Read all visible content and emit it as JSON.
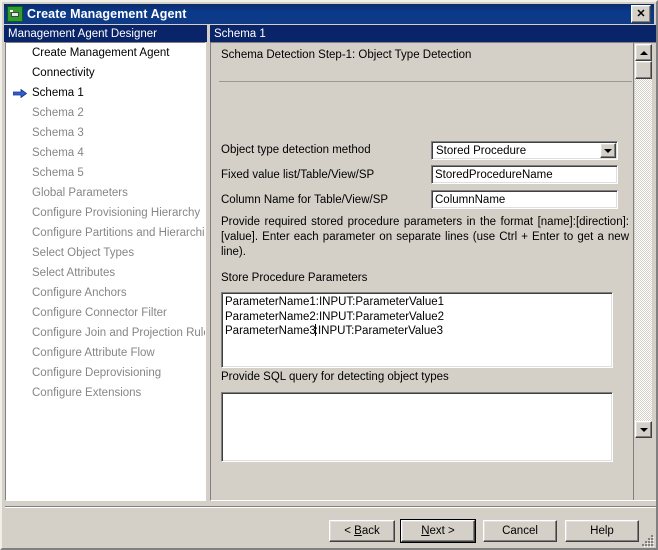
{
  "window": {
    "title": "Create Management Agent",
    "app_icon": "management-agent-icon",
    "close_label": "✕"
  },
  "left_panel": {
    "header": "Management Agent Designer",
    "items": [
      {
        "label": "Create Management Agent",
        "state": "done",
        "current": false
      },
      {
        "label": "Connectivity",
        "state": "done",
        "current": false
      },
      {
        "label": "Schema 1",
        "state": "current",
        "current": true
      },
      {
        "label": "Schema 2",
        "state": "disabled",
        "current": false
      },
      {
        "label": "Schema 3",
        "state": "disabled",
        "current": false
      },
      {
        "label": "Schema 4",
        "state": "disabled",
        "current": false
      },
      {
        "label": "Schema 5",
        "state": "disabled",
        "current": false
      },
      {
        "label": "Global Parameters",
        "state": "disabled",
        "current": false
      },
      {
        "label": "Configure Provisioning Hierarchy",
        "state": "disabled",
        "current": false
      },
      {
        "label": "Configure Partitions and Hierarchies",
        "state": "disabled",
        "current": false
      },
      {
        "label": "Select Object Types",
        "state": "disabled",
        "current": false
      },
      {
        "label": "Select Attributes",
        "state": "disabled",
        "current": false
      },
      {
        "label": "Configure Anchors",
        "state": "disabled",
        "current": false
      },
      {
        "label": "Configure Connector Filter",
        "state": "disabled",
        "current": false
      },
      {
        "label": "Configure Join and Projection Rules",
        "state": "disabled",
        "current": false
      },
      {
        "label": "Configure Attribute Flow",
        "state": "disabled",
        "current": false
      },
      {
        "label": "Configure Deprovisioning",
        "state": "disabled",
        "current": false
      },
      {
        "label": "Configure Extensions",
        "state": "disabled",
        "current": false
      }
    ]
  },
  "right_panel": {
    "header": "Schema 1",
    "step_title": "Schema Detection Step-1:  Object Type Detection",
    "fields": {
      "detection_method_label": "Object type detection method",
      "detection_method_value": "Stored Procedure",
      "fixed_value_label": "Fixed value list/Table/View/SP",
      "fixed_value_value": "StoredProcedureName",
      "column_name_label": "Column Name for Table/View/SP",
      "column_name_value": "ColumnName"
    },
    "help_text": "Provide required stored procedure parameters in the format [name]:[direction]:[value]. Enter each parameter on separate lines (use Ctrl + Enter to get a new line).",
    "sp_params_label": "Store Procedure Parameters",
    "sp_params_line1": "ParameterName1:INPUT:ParameterValue1",
    "sp_params_line2": "ParameterName2:INPUT:ParameterValue2",
    "sp_params_line3_before_caret": "ParameterName3",
    "sp_params_line3_after_caret": ":INPUT:ParameterValue3",
    "sql_query_label": "Provide SQL query for detecting object types",
    "sql_query_value": ""
  },
  "footer": {
    "back_prefix": "< ",
    "back_accel": "B",
    "back_suffix": "ack",
    "next_accel": "N",
    "next_suffix": "ext >",
    "cancel": "Cancel",
    "help": "Help"
  },
  "colors": {
    "titlebar": "#0a246a",
    "face": "#d4d0c8",
    "arrow_blue": "#2147b0",
    "disabled_text": "#868686"
  }
}
